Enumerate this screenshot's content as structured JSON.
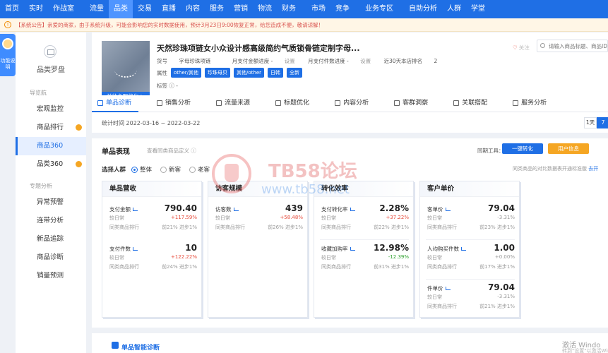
{
  "nav": {
    "items": [
      "首页",
      "实时",
      "作战室",
      "流量",
      "品类",
      "交易",
      "直播",
      "内容",
      "服务",
      "营销",
      "物流",
      "财务",
      "市场",
      "竞争",
      "业务专区",
      "自助分析",
      "人群",
      "学堂"
    ],
    "active_index": 4
  },
  "notice": {
    "text": "【系统公告】亲爱的商家，由于系统升级，可能会影响您的实时数据使用，预计3月23日9:00恢复正常，给您造成不便，敬请谅解！"
  },
  "helper": {
    "label": "功能说明"
  },
  "sidebar": {
    "title": "品类罗盘",
    "group1": "导览航",
    "items": [
      {
        "label": "宏观监控"
      },
      {
        "label": "商品排行"
      },
      {
        "label": "商品360"
      },
      {
        "label": "品类360"
      }
    ],
    "group2": "专题分析",
    "items2": [
      {
        "label": "异常预警"
      },
      {
        "label": "连带分析"
      },
      {
        "label": "新品追踪"
      },
      {
        "label": "商品诊断"
      },
      {
        "label": "销量预测"
      }
    ]
  },
  "product": {
    "image_button": "前往主图优化 >",
    "title": "天然珍珠项链女小众设计感高级简约气质锁骨链定制字母...",
    "meta": {
      "sku_label": "货号",
      "sku_value": "字母珍珠项链",
      "month_amount_label": "月支付金额进度 -",
      "month_amount_action": "设置",
      "month_count_label": "月支付件数进度 -",
      "month_count_action": "设置",
      "rank_label": "近30天本店排名",
      "rank_value": "2"
    },
    "attr_label": "属性",
    "attrs": [
      "other/其他",
      "珍珠母贝",
      "其他/other",
      "日韩",
      "全新"
    ],
    "tags_label": "标签",
    "tags_value": "-",
    "fav": "关注"
  },
  "search": {
    "placeholder": "请输入商品标题、商品ID..."
  },
  "tabs": [
    "单品诊断",
    "销售分析",
    "流量来源",
    "标题优化",
    "内容分析",
    "客群洞察",
    "关联搭配",
    "服务分析"
  ],
  "stat": {
    "time_label": "统计时间 2022-03-16 ~ 2022-03-22",
    "seg": [
      "1天",
      "7"
    ]
  },
  "panel": {
    "title": "单品表现",
    "subtitle": "查看同类商品定义",
    "peer_tool": "同期工具：",
    "btn_blue": "一键转化",
    "btn_orange": "用户信息",
    "crowd_label": "选择人群",
    "crowd_options": [
      "整体",
      "新客",
      "老客"
    ],
    "peer_note": "同类商品的对比数据表开通标准版",
    "peer_note_link": "去开"
  },
  "cards": [
    {
      "title": "单品营收",
      "metrics": [
        {
          "name": "支付金额",
          "value": "790.40",
          "vs": "较日常",
          "change": "+117.59%",
          "rank_label": "同类商品排行",
          "rank": "前21% 进步1%"
        },
        {
          "name": "支付件数",
          "value": "10",
          "vs": "较日常",
          "change": "+122.22%",
          "rank_label": "同类商品排行",
          "rank": "前24% 进步1%"
        }
      ]
    },
    {
      "title": "访客规模",
      "metrics": [
        {
          "name": "访客数",
          "value": "439",
          "vs": "较日常",
          "change": "+58.48%",
          "rank_label": "同类商品排行",
          "rank": "前26% 进步1%"
        }
      ]
    },
    {
      "title": "转化效率",
      "metrics": [
        {
          "name": "支付转化率",
          "value": "2.28%",
          "vs": "较日常",
          "change": "+37.22%",
          "rank_label": "同类商品排行",
          "rank": "前22% 进步1%"
        },
        {
          "name": "收藏加购率",
          "value": "12.98%",
          "vs": "较日常",
          "change": "-12.39%",
          "rank_label": "同类商品排行",
          "rank": "前31% 进步1%"
        }
      ]
    },
    {
      "title": "客户单价",
      "metrics": [
        {
          "name": "客单价",
          "value": "79.04",
          "vs": "较日常",
          "change": "-3.31%",
          "rank_label": "同类商品排行",
          "rank": "前23% 进步1%"
        },
        {
          "name": "人均购买件数",
          "value": "1.00",
          "vs": "较日常",
          "change": "+0.00%",
          "rank_label": "同类商品排行",
          "rank": "前17% 进步1%"
        },
        {
          "name": "件单价",
          "value": "79.04",
          "vs": "较日常",
          "change": "-3.31%",
          "rank_label": "同类商品排行",
          "rank": "前21% 进步1%"
        }
      ]
    }
  ],
  "diag": {
    "title": "单品智能诊断"
  },
  "watermark": {
    "line1": "TB58论坛",
    "line2": "www.tb58.net"
  },
  "os": {
    "activate": "激活 Windo",
    "activate_sub": "转到\"设置\"以激活Windows"
  },
  "colors": {
    "primary": "#1f6fe5",
    "accent": "#f5a623",
    "up": "#e74c3c",
    "down_green": "#2ca02c"
  }
}
